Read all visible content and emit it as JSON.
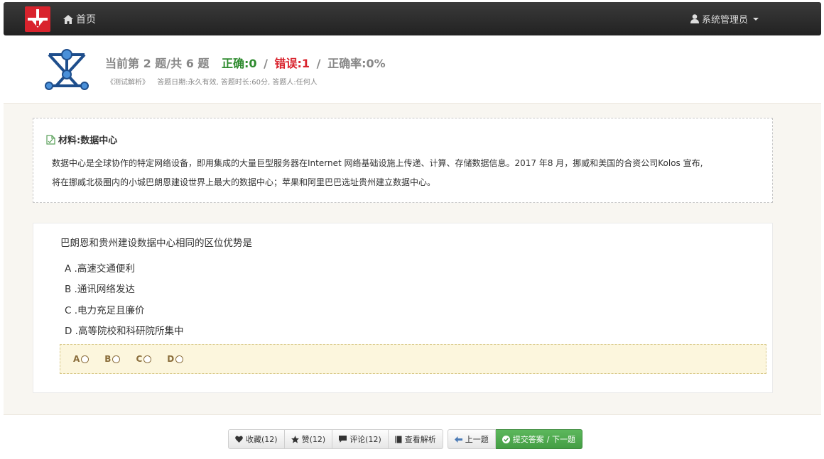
{
  "nav": {
    "home_label": "首页",
    "user_label": "系统管理员",
    "logo_color": "#d9232d"
  },
  "header": {
    "progress_text": "当前第 2 题/共 6 题",
    "correct_text": "正确:0",
    "wrong_text": "错误:1",
    "rate_text": "正确率:0%",
    "separator": "/",
    "book": "《测试解析》",
    "meta": "答题日期:永久有效, 答题时长:60分, 答题人:任何人"
  },
  "material": {
    "title": "材料:数据中心",
    "line1": "数据中心是全球协作的特定网络设备，即用集成的大量巨型服务器在Internet 网络基础设施上传递、计算、存储数据信息。2017 年8 月，挪威和美国的合资公司Kolos 宣布,",
    "line2": "将在挪威北极圈内的小城巴朗恩建设世界上最大的数据中心；苹果和阿里巴巴选址贵州建立数据中心。"
  },
  "question": {
    "stem": "巴朗恩和贵州建设数据中心相同的区位优势是",
    "options": [
      {
        "label": "A .高速交通便利"
      },
      {
        "label": "B .通讯网络发达"
      },
      {
        "label": "C .电力充足且廉价"
      },
      {
        "label": "D .高等院校和科研院所集中"
      }
    ],
    "choices": [
      "A",
      "B",
      "C",
      "D"
    ]
  },
  "toolbar": {
    "favorite": "收藏(12)",
    "like": "赞(12)",
    "comment": "评论(12)",
    "analysis": "查看解析",
    "prev": "上一题",
    "submit": "提交答案",
    "next": "/ 下一题"
  }
}
